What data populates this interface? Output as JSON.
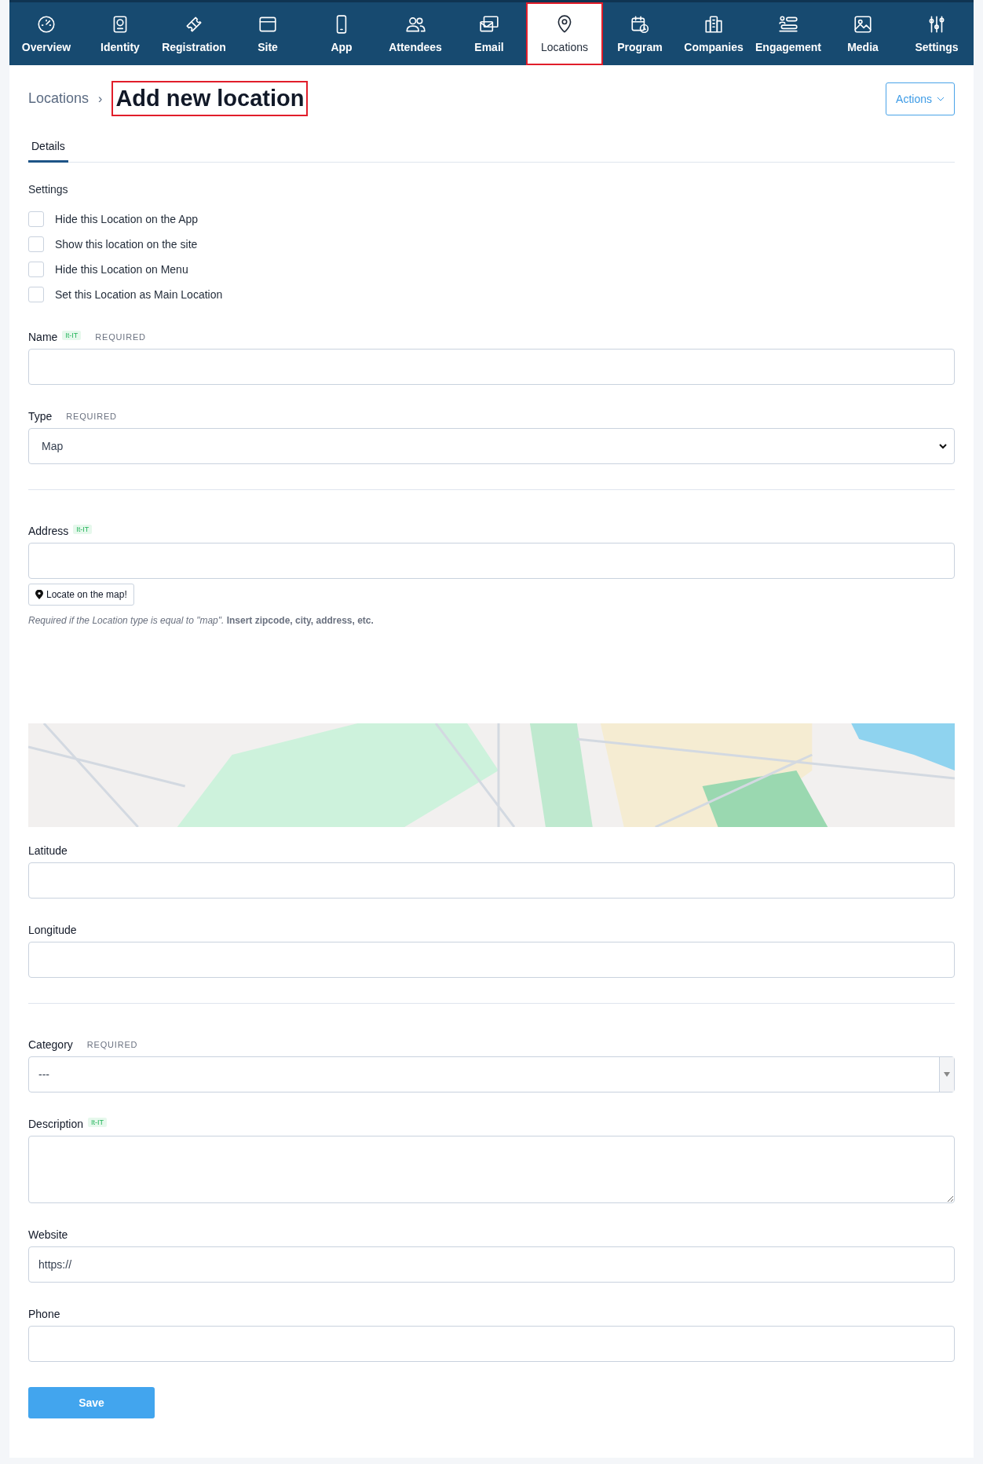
{
  "nav": {
    "items": [
      {
        "label": "Overview",
        "selected": false,
        "highlighted": false
      },
      {
        "label": "Identity",
        "selected": false,
        "highlighted": false
      },
      {
        "label": "Registration",
        "selected": false,
        "highlighted": false
      },
      {
        "label": "Site",
        "selected": false,
        "highlighted": false
      },
      {
        "label": "App",
        "selected": false,
        "highlighted": false
      },
      {
        "label": "Attendees",
        "selected": false,
        "highlighted": false
      },
      {
        "label": "Email",
        "selected": false,
        "highlighted": false
      },
      {
        "label": "Locations",
        "selected": true,
        "highlighted": true
      },
      {
        "label": "Program",
        "selected": false,
        "highlighted": false
      },
      {
        "label": "Companies",
        "selected": false,
        "highlighted": false
      },
      {
        "label": "Engagement",
        "selected": false,
        "highlighted": false
      },
      {
        "label": "Media",
        "selected": false,
        "highlighted": false
      },
      {
        "label": "Settings",
        "selected": false,
        "highlighted": false
      }
    ]
  },
  "breadcrumb": {
    "parent": "Locations",
    "separator": "›",
    "title": "Add new location",
    "title_highlighted": true
  },
  "actions_button": {
    "label": "Actions"
  },
  "tabs": [
    {
      "label": "Details",
      "selected": true
    }
  ],
  "settings": {
    "heading": "Settings",
    "options": [
      {
        "label": "Hide this Location on the App",
        "checked": false
      },
      {
        "label": "Show this location on the site",
        "checked": false
      },
      {
        "label": "Hide this Location on Menu",
        "checked": false
      },
      {
        "label": "Set this Location as Main Location",
        "checked": false
      }
    ]
  },
  "fields": [
    {
      "kind": "text",
      "label": "Name",
      "badge": "It-IT",
      "required": "REQUIRED"
    },
    {
      "kind": "select",
      "label": "Type",
      "required": "REQUIRED",
      "value": "Map"
    },
    {
      "kind": "divider"
    },
    {
      "kind": "address",
      "label": "Address",
      "badge": "It-IT",
      "button": "Locate on the map!",
      "help": "*Required if the Location type is equal to \"map\".* **Insert zipcode, city, address, etc.**"
    },
    {
      "kind": "map"
    },
    {
      "kind": "text",
      "label": "Latitude"
    },
    {
      "kind": "text",
      "label": "Longitude"
    },
    {
      "kind": "divider"
    },
    {
      "kind": "combo",
      "label": "Category",
      "required": "REQUIRED",
      "value": "---"
    },
    {
      "kind": "textarea",
      "label": "Description",
      "badge": "It-IT"
    },
    {
      "kind": "text",
      "label": "Website",
      "value": "https://"
    },
    {
      "kind": "text",
      "label": "Phone"
    }
  ],
  "save_button": {
    "label": "Save"
  }
}
